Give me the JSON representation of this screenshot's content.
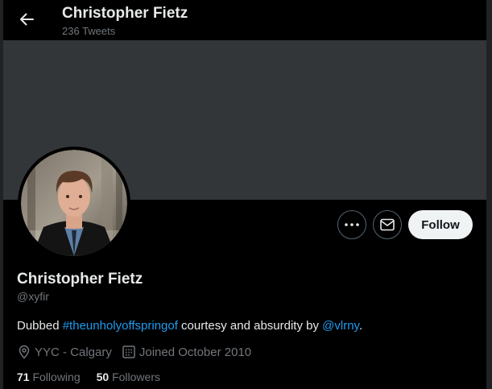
{
  "header": {
    "title": "Christopher Fietz",
    "subtitle": "236 Tweets"
  },
  "colors": {
    "background": "#000000",
    "banner": "#333639",
    "link": "#1d9bf0",
    "muted": "#71767b",
    "follow_button_bg": "#eff3f4"
  },
  "actions": {
    "more_icon": "more-icon",
    "message_icon": "envelope-icon",
    "follow_label": "Follow"
  },
  "profile": {
    "name": "Christopher Fietz",
    "handle": "@xyfir",
    "bio": {
      "prefix": "Dubbed ",
      "hashtag": "#theunholyoffspringof",
      "middle": " courtesy and absurdity by ",
      "mention": "@vlrny",
      "suffix": "."
    },
    "location": "YYC - Calgary",
    "joined": "Joined October 2010"
  },
  "stats": {
    "following_count": "71",
    "following_label": "Following",
    "followers_count": "50",
    "followers_label": "Followers"
  }
}
